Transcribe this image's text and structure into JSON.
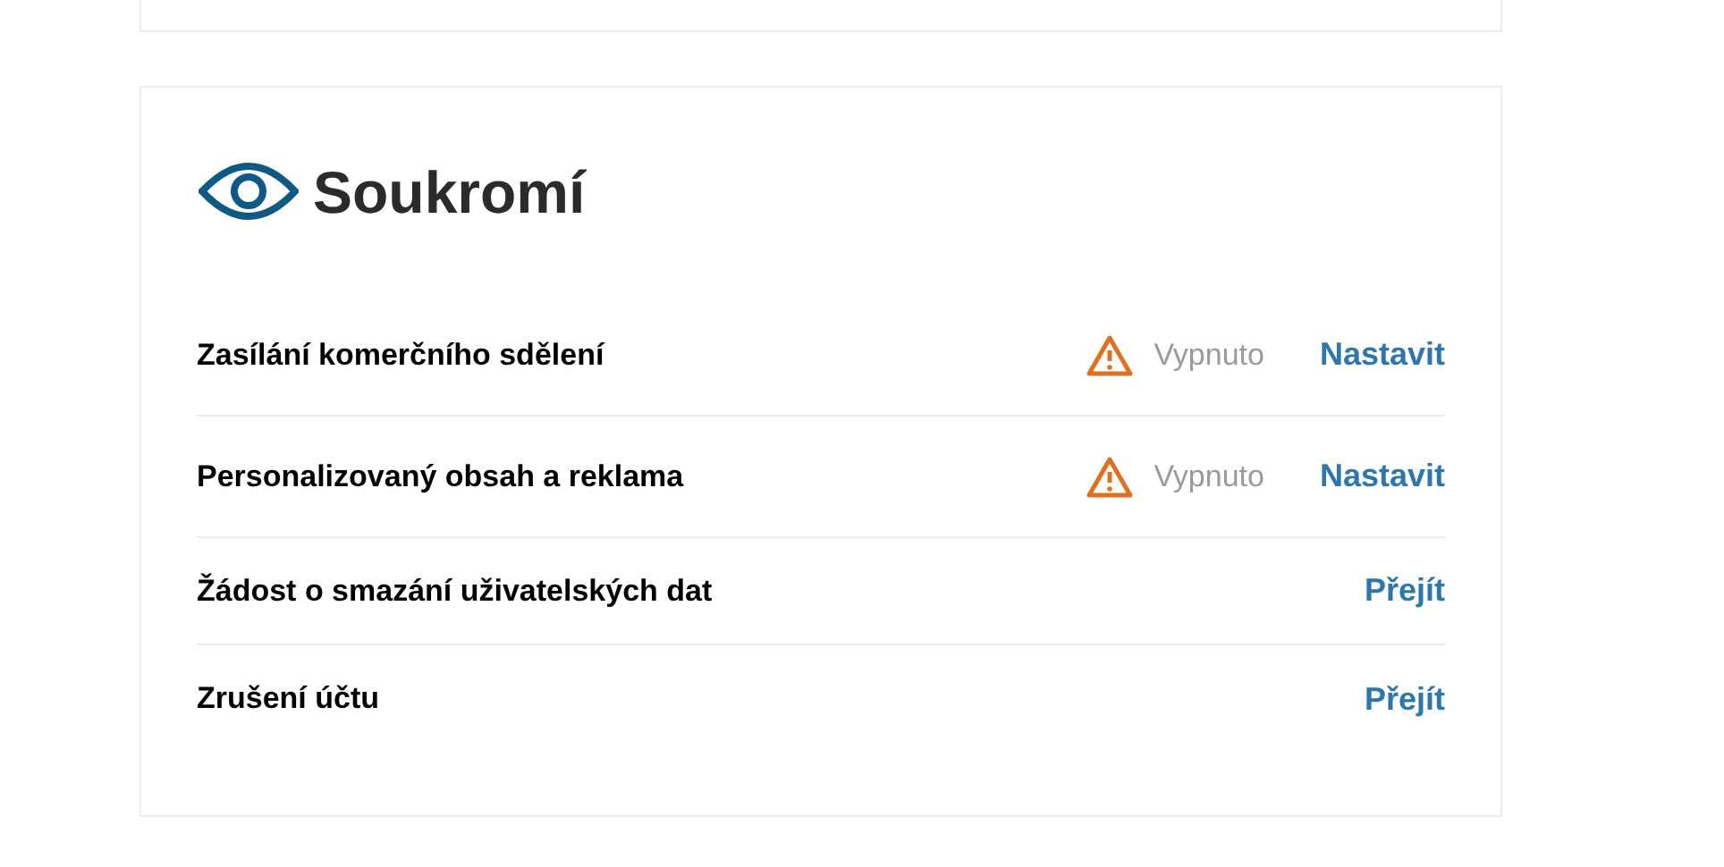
{
  "section": {
    "title": "Soukromí"
  },
  "rows": [
    {
      "label": "Zasílání komerčního sdělení",
      "status": "Vypnuto",
      "action": "Nastavit"
    },
    {
      "label": "Personalizovaný obsah a reklama",
      "status": "Vypnuto",
      "action": "Nastavit"
    },
    {
      "label": "Žádost o smazání uživatelských dat",
      "action": "Přejít"
    },
    {
      "label": "Zrušení účtu",
      "action": "Přejít"
    }
  ]
}
